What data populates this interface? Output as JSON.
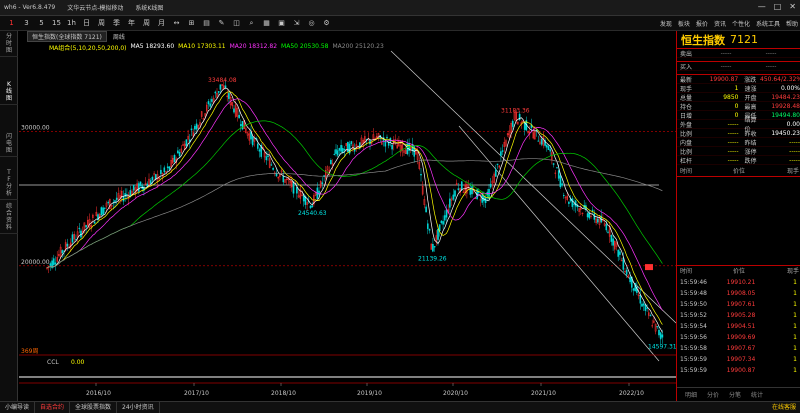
{
  "window": {
    "title": "wh6 - Ver6.8.479",
    "subtitle": "文华云节点-模拟移动",
    "window_label": "系统K线图",
    "controls": [
      "—",
      "□",
      "✕"
    ]
  },
  "toolbar": {
    "periods": [
      "1",
      "3",
      "5",
      "15",
      "1h",
      "日",
      "周",
      "季",
      "年",
      "周",
      "月",
      "↔",
      "⊞",
      "▤",
      "✎",
      "◫",
      "⌕",
      "▦",
      "▣",
      "⇲",
      "◎",
      "⚙"
    ],
    "active_index": 0,
    "right_menu": [
      "发现",
      "板块",
      "报价",
      "资讯",
      "个性化",
      "系统工具",
      "帮助"
    ]
  },
  "left_strip": [
    "分时图",
    "K线图",
    "闪电图",
    "TF分析",
    "综合资料"
  ],
  "chart": {
    "tab_label": "恒生指数(全球指数 7121)",
    "period_label": "周线",
    "ma_label": "MA组合(5,10,20,50,200,0)",
    "ma_values": [
      {
        "label": "MA5 18293.60",
        "color": "#ffffff"
      },
      {
        "label": "MA10 17303.11",
        "color": "#ffff00"
      },
      {
        "label": "MA20 18312.82",
        "color": "#ff33ff"
      },
      {
        "label": "MA50 20530.58",
        "color": "#00ff00"
      },
      {
        "label": "MA200 25120.23",
        "color": "#888888"
      }
    ],
    "y_ticks": [
      "30000.00",
      "20000.00"
    ],
    "x_ticks": [
      "2016/10",
      "2017/10",
      "2018/10",
      "2019/10",
      "2020/10",
      "2021/10",
      "2022/10"
    ],
    "annotations": [
      "33484.08",
      "24540.63",
      "31183.36",
      "21139.26",
      "14597.31"
    ],
    "bars_label": "369周",
    "ccl_label": "CCL",
    "ccl_value": "0.00"
  },
  "chart_data": {
    "type": "line",
    "x": [
      "2016/10",
      "2017/10",
      "2018/10",
      "2019/10",
      "2020/10",
      "2021/10",
      "2022/10"
    ],
    "series": [
      {
        "values": [
          22500,
          28500,
          26500,
          27000,
          24000,
          25000,
          16500
        ]
      }
    ],
    "ylim": [
      13500,
      36000
    ]
  },
  "quote": {
    "name": "恒生指数",
    "code": "7121",
    "bid_label": "卖出",
    "ask_label": "买入",
    "dash": "-----",
    "rows": [
      {
        "l1": "最新",
        "v1": "19900.87",
        "c1": "#ff3b3b",
        "l2": "涨跌",
        "v2": "450.64/2.32%",
        "c2": "#ff3b3b"
      },
      {
        "l1": "现手",
        "v1": "1",
        "c1": "#ffff00",
        "l2": "速涨",
        "v2": "0.00%",
        "c2": "#ffffff"
      },
      {
        "l1": "总量",
        "v1": "9850",
        "c1": "#ffff00",
        "l2": "开盘",
        "v2": "19484.23",
        "c2": "#ff3b3b"
      },
      {
        "l1": "持仓",
        "v1": "0",
        "c1": "#ffff00",
        "l2": "最高",
        "v2": "19928.48",
        "c2": "#ff3b3b"
      },
      {
        "l1": "日增",
        "v1": "0",
        "c1": "#ffff00",
        "l2": "最低",
        "v2": "19494.80",
        "c2": "#00ff66"
      },
      {
        "l1": "外盘",
        "v1": "-----",
        "c1": "#ffff00",
        "l2": "结算价",
        "v2": "0.00",
        "c2": "#ffffff"
      },
      {
        "l1": "比例",
        "v1": "-----",
        "c1": "#ffff00",
        "l2": "昨收",
        "v2": "19450.23",
        "c2": "#ffffff"
      },
      {
        "l1": "内盘",
        "v1": "-----",
        "c1": "#ffff00",
        "l2": "昨结",
        "v2": "-----",
        "c2": "#ffff00"
      },
      {
        "l1": "比例",
        "v1": "-----",
        "c1": "#ffff00",
        "l2": "涨停",
        "v2": "-----",
        "c2": "#ffff00"
      },
      {
        "l1": "杠杆",
        "v1": "-----",
        "c1": "#ffff00",
        "l2": "跌停",
        "v2": "-----",
        "c2": "#ffff00"
      }
    ],
    "fin_headers": [
      "时间",
      "价位",
      "现手"
    ],
    "tick_headers": [
      "时间",
      "价位",
      "现手"
    ],
    "ticks": [
      {
        "t": "15:59:46",
        "p": "19910.21",
        "v": "1"
      },
      {
        "t": "15:59:48",
        "p": "19908.05",
        "v": "1"
      },
      {
        "t": "15:59:50",
        "p": "19907.61",
        "v": "1"
      },
      {
        "t": "15:59:52",
        "p": "19905.28",
        "v": "1"
      },
      {
        "t": "15:59:54",
        "p": "19904.51",
        "v": "1"
      },
      {
        "t": "15:59:56",
        "p": "19909.69",
        "v": "1"
      },
      {
        "t": "15:59:58",
        "p": "19907.67",
        "v": "1"
      },
      {
        "t": "15:59:59",
        "p": "19907.34",
        "v": "1"
      },
      {
        "t": "15:59:59",
        "p": "19900.87",
        "v": "1"
      }
    ],
    "bottom_tabs": [
      "明细",
      "分价",
      "分笔",
      "统计"
    ]
  },
  "status": {
    "items": [
      "小编导读",
      "自选合约",
      "全球股票指数",
      "24小时资讯"
    ],
    "active_index": 1,
    "right_text": "在线客服"
  }
}
